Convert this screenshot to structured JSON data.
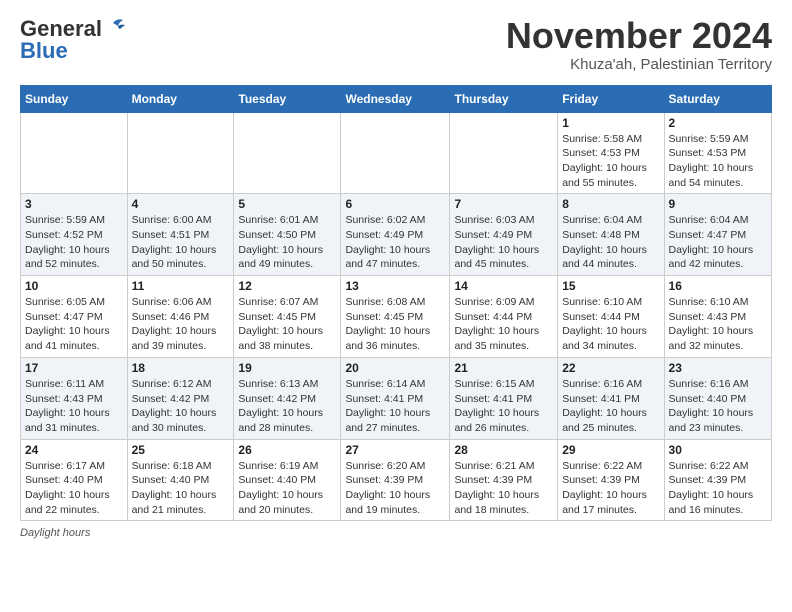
{
  "header": {
    "logo_general": "General",
    "logo_blue": "Blue",
    "month_title": "November 2024",
    "location": "Khuza'ah, Palestinian Territory"
  },
  "footer": {
    "daylight_label": "Daylight hours"
  },
  "weekdays": [
    "Sunday",
    "Monday",
    "Tuesday",
    "Wednesday",
    "Thursday",
    "Friday",
    "Saturday"
  ],
  "weeks": [
    [
      {
        "day": "",
        "sunrise": "",
        "sunset": "",
        "daylight": ""
      },
      {
        "day": "",
        "sunrise": "",
        "sunset": "",
        "daylight": ""
      },
      {
        "day": "",
        "sunrise": "",
        "sunset": "",
        "daylight": ""
      },
      {
        "day": "",
        "sunrise": "",
        "sunset": "",
        "daylight": ""
      },
      {
        "day": "",
        "sunrise": "",
        "sunset": "",
        "daylight": ""
      },
      {
        "day": "1",
        "sunrise": "Sunrise: 5:58 AM",
        "sunset": "Sunset: 4:53 PM",
        "daylight": "Daylight: 10 hours and 55 minutes."
      },
      {
        "day": "2",
        "sunrise": "Sunrise: 5:59 AM",
        "sunset": "Sunset: 4:53 PM",
        "daylight": "Daylight: 10 hours and 54 minutes."
      }
    ],
    [
      {
        "day": "3",
        "sunrise": "Sunrise: 5:59 AM",
        "sunset": "Sunset: 4:52 PM",
        "daylight": "Daylight: 10 hours and 52 minutes."
      },
      {
        "day": "4",
        "sunrise": "Sunrise: 6:00 AM",
        "sunset": "Sunset: 4:51 PM",
        "daylight": "Daylight: 10 hours and 50 minutes."
      },
      {
        "day": "5",
        "sunrise": "Sunrise: 6:01 AM",
        "sunset": "Sunset: 4:50 PM",
        "daylight": "Daylight: 10 hours and 49 minutes."
      },
      {
        "day": "6",
        "sunrise": "Sunrise: 6:02 AM",
        "sunset": "Sunset: 4:49 PM",
        "daylight": "Daylight: 10 hours and 47 minutes."
      },
      {
        "day": "7",
        "sunrise": "Sunrise: 6:03 AM",
        "sunset": "Sunset: 4:49 PM",
        "daylight": "Daylight: 10 hours and 45 minutes."
      },
      {
        "day": "8",
        "sunrise": "Sunrise: 6:04 AM",
        "sunset": "Sunset: 4:48 PM",
        "daylight": "Daylight: 10 hours and 44 minutes."
      },
      {
        "day": "9",
        "sunrise": "Sunrise: 6:04 AM",
        "sunset": "Sunset: 4:47 PM",
        "daylight": "Daylight: 10 hours and 42 minutes."
      }
    ],
    [
      {
        "day": "10",
        "sunrise": "Sunrise: 6:05 AM",
        "sunset": "Sunset: 4:47 PM",
        "daylight": "Daylight: 10 hours and 41 minutes."
      },
      {
        "day": "11",
        "sunrise": "Sunrise: 6:06 AM",
        "sunset": "Sunset: 4:46 PM",
        "daylight": "Daylight: 10 hours and 39 minutes."
      },
      {
        "day": "12",
        "sunrise": "Sunrise: 6:07 AM",
        "sunset": "Sunset: 4:45 PM",
        "daylight": "Daylight: 10 hours and 38 minutes."
      },
      {
        "day": "13",
        "sunrise": "Sunrise: 6:08 AM",
        "sunset": "Sunset: 4:45 PM",
        "daylight": "Daylight: 10 hours and 36 minutes."
      },
      {
        "day": "14",
        "sunrise": "Sunrise: 6:09 AM",
        "sunset": "Sunset: 4:44 PM",
        "daylight": "Daylight: 10 hours and 35 minutes."
      },
      {
        "day": "15",
        "sunrise": "Sunrise: 6:10 AM",
        "sunset": "Sunset: 4:44 PM",
        "daylight": "Daylight: 10 hours and 34 minutes."
      },
      {
        "day": "16",
        "sunrise": "Sunrise: 6:10 AM",
        "sunset": "Sunset: 4:43 PM",
        "daylight": "Daylight: 10 hours and 32 minutes."
      }
    ],
    [
      {
        "day": "17",
        "sunrise": "Sunrise: 6:11 AM",
        "sunset": "Sunset: 4:43 PM",
        "daylight": "Daylight: 10 hours and 31 minutes."
      },
      {
        "day": "18",
        "sunrise": "Sunrise: 6:12 AM",
        "sunset": "Sunset: 4:42 PM",
        "daylight": "Daylight: 10 hours and 30 minutes."
      },
      {
        "day": "19",
        "sunrise": "Sunrise: 6:13 AM",
        "sunset": "Sunset: 4:42 PM",
        "daylight": "Daylight: 10 hours and 28 minutes."
      },
      {
        "day": "20",
        "sunrise": "Sunrise: 6:14 AM",
        "sunset": "Sunset: 4:41 PM",
        "daylight": "Daylight: 10 hours and 27 minutes."
      },
      {
        "day": "21",
        "sunrise": "Sunrise: 6:15 AM",
        "sunset": "Sunset: 4:41 PM",
        "daylight": "Daylight: 10 hours and 26 minutes."
      },
      {
        "day": "22",
        "sunrise": "Sunrise: 6:16 AM",
        "sunset": "Sunset: 4:41 PM",
        "daylight": "Daylight: 10 hours and 25 minutes."
      },
      {
        "day": "23",
        "sunrise": "Sunrise: 6:16 AM",
        "sunset": "Sunset: 4:40 PM",
        "daylight": "Daylight: 10 hours and 23 minutes."
      }
    ],
    [
      {
        "day": "24",
        "sunrise": "Sunrise: 6:17 AM",
        "sunset": "Sunset: 4:40 PM",
        "daylight": "Daylight: 10 hours and 22 minutes."
      },
      {
        "day": "25",
        "sunrise": "Sunrise: 6:18 AM",
        "sunset": "Sunset: 4:40 PM",
        "daylight": "Daylight: 10 hours and 21 minutes."
      },
      {
        "day": "26",
        "sunrise": "Sunrise: 6:19 AM",
        "sunset": "Sunset: 4:40 PM",
        "daylight": "Daylight: 10 hours and 20 minutes."
      },
      {
        "day": "27",
        "sunrise": "Sunrise: 6:20 AM",
        "sunset": "Sunset: 4:39 PM",
        "daylight": "Daylight: 10 hours and 19 minutes."
      },
      {
        "day": "28",
        "sunrise": "Sunrise: 6:21 AM",
        "sunset": "Sunset: 4:39 PM",
        "daylight": "Daylight: 10 hours and 18 minutes."
      },
      {
        "day": "29",
        "sunrise": "Sunrise: 6:22 AM",
        "sunset": "Sunset: 4:39 PM",
        "daylight": "Daylight: 10 hours and 17 minutes."
      },
      {
        "day": "30",
        "sunrise": "Sunrise: 6:22 AM",
        "sunset": "Sunset: 4:39 PM",
        "daylight": "Daylight: 10 hours and 16 minutes."
      }
    ]
  ]
}
